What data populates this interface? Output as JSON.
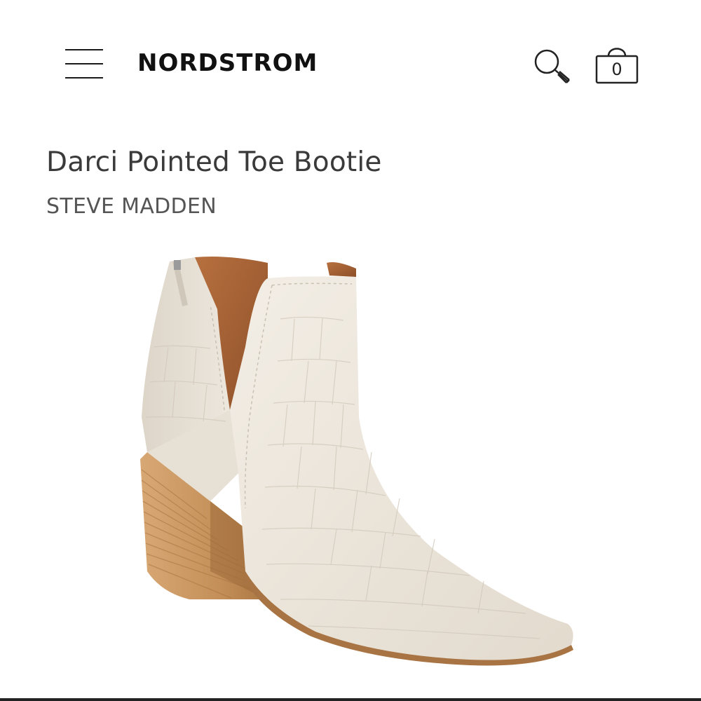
{
  "header": {
    "brand": "NORDSTROM",
    "menu_icon": "hamburger-menu-icon",
    "search_icon": "search-icon",
    "bag_icon": "shopping-bag-icon",
    "bag_count": "0"
  },
  "product": {
    "title": "Darci Pointed Toe Bootie",
    "brand": "STEVE MADDEN",
    "image": "ivory croc-embossed pointed toe ankle bootie with stacked wood block heel"
  },
  "colors": {
    "text_primary": "#111111",
    "text_title": "#3a3a3a",
    "boot_leather": "#ede7dc",
    "boot_lining": "#a8643a",
    "heel_wood": "#c9955e"
  }
}
